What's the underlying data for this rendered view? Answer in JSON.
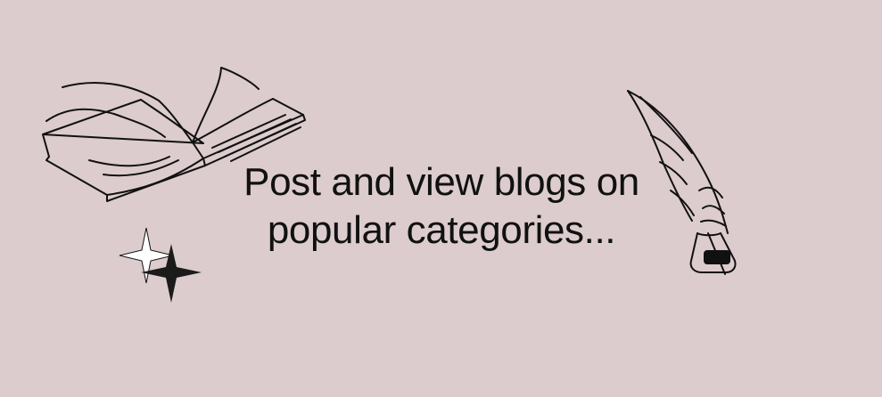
{
  "banner": {
    "background_color": "#dccccd",
    "ink_color": "#111111",
    "tagline": {
      "line_1": "Post and view blogs on",
      "line_2": "popular categories..."
    },
    "decorations": {
      "left_top": "open-book-icon",
      "left_bottom": "sparkles-icon",
      "right": "quill-and-inkwell-icon"
    }
  }
}
